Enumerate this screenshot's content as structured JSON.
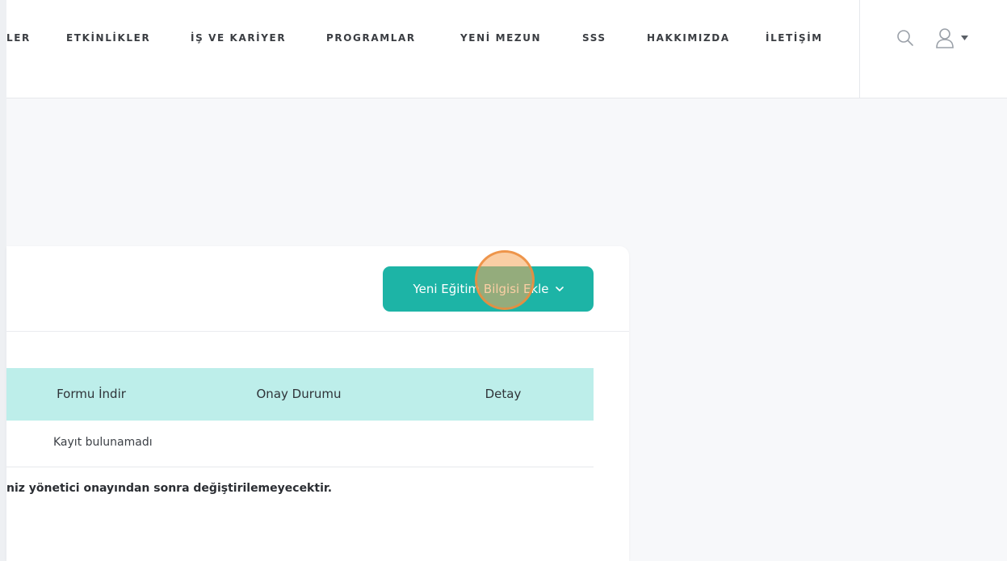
{
  "nav": {
    "items": [
      {
        "label": "LER"
      },
      {
        "label": "ETKİNLİKLER"
      },
      {
        "label": "İŞ VE KARİYER"
      },
      {
        "label": "PROGRAMLAR"
      },
      {
        "label": "YENİ MEZUN"
      },
      {
        "label": "SSS"
      },
      {
        "label": "HAKKIMIZDA"
      },
      {
        "label": "İLETİŞİM"
      }
    ],
    "icons": {
      "search": "search-icon",
      "user": "user-icon",
      "caret": "caret-down-icon"
    }
  },
  "card": {
    "add_button_label": "Yeni Eğitim Bilgisi Ekle",
    "table": {
      "headers": [
        "Formu İndir",
        "Onay Durumu",
        "Detay"
      ],
      "empty_text": "Kayıt bulunamadı"
    },
    "note": "niz yönetici onayından sonra değiştirilemeyecektir."
  },
  "colors": {
    "accent": "#1db4a6",
    "table_header_bg": "#bdeeea",
    "click_marker": "#f5a65a"
  }
}
